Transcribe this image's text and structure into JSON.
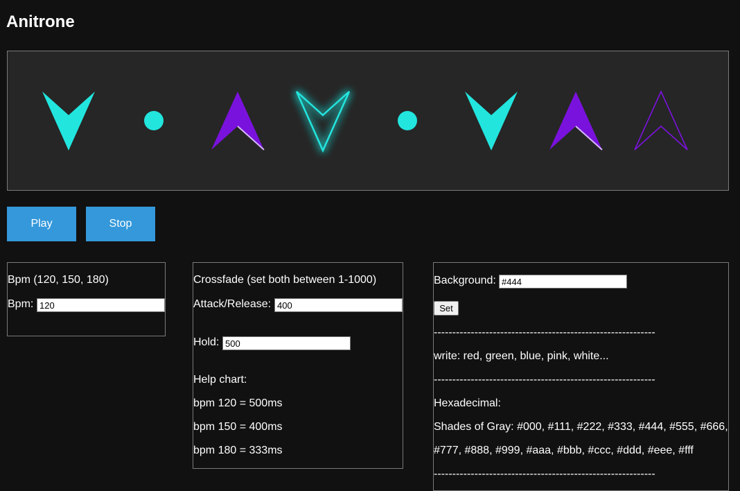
{
  "app": {
    "title": "Anitrone"
  },
  "colors": {
    "background": "#111111",
    "stage_background": "#262626",
    "cyan": "#22e5de",
    "purple": "#7a12dd",
    "button": "#3498db"
  },
  "stage": {
    "shapes": [
      {
        "kind": "arrow-down",
        "style": "filled",
        "color": "cyan"
      },
      {
        "kind": "dot",
        "style": "filled",
        "color": "cyan"
      },
      {
        "kind": "arrow-up",
        "style": "filled",
        "color": "purple"
      },
      {
        "kind": "arrow-down",
        "style": "outline-glow",
        "color": "cyan"
      },
      {
        "kind": "dot",
        "style": "filled",
        "color": "cyan"
      },
      {
        "kind": "arrow-down",
        "style": "filled",
        "color": "cyan"
      },
      {
        "kind": "arrow-up",
        "style": "filled",
        "color": "purple"
      },
      {
        "kind": "arrow-up",
        "style": "outline",
        "color": "purple"
      }
    ]
  },
  "controls": {
    "play_label": "Play",
    "stop_label": "Stop"
  },
  "bpm_panel": {
    "heading": "Bpm (120, 150, 180)",
    "label": "Bpm:",
    "value": "120"
  },
  "crossfade_panel": {
    "heading": "Crossfade (set both between 1-1000)",
    "attack_label": "Attack/Release:",
    "attack_value": "400",
    "hold_label": "Hold:",
    "hold_value": "500",
    "help_title": "Help chart:",
    "help_lines": [
      "bpm 120 = 500ms",
      "bpm 150 = 400ms",
      "bpm 180 = 333ms"
    ]
  },
  "background_panel": {
    "label": "Background:",
    "value": "#444",
    "set_label": "Set",
    "separator": "------------------------------------------------------------",
    "write_hint": "write: red, green, blue, pink, white...",
    "hex_title": "Hexadecimal:",
    "gray_line_1": "Shades of Gray: #000, #111, #222, #333, #444, #555, #666,",
    "gray_line_2": "#777, #888, #999, #aaa, #bbb, #ccc, #ddd, #eee, #fff"
  }
}
